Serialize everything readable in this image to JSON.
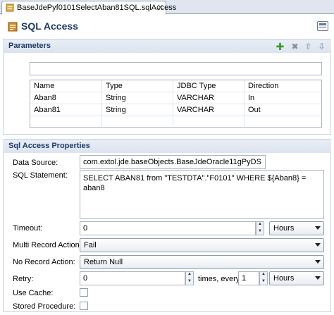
{
  "editor_tab": {
    "label": "BaseJdePyf0101SelectAban81SQL.sqlAccess",
    "close": "✕"
  },
  "header": {
    "title": "SQL Access"
  },
  "parameters": {
    "title": "Parameters",
    "filter_value": "",
    "columns": [
      "Name",
      "Type",
      "JDBC Type",
      "Direction"
    ],
    "rows": [
      [
        "Aban8",
        "String",
        "VARCHAR",
        "In"
      ],
      [
        "Aban81",
        "String",
        "VARCHAR",
        "Out"
      ]
    ]
  },
  "properties": {
    "title": "Sql Access Properties",
    "data_source_label": "Data Source:",
    "data_source_value": "com.extol.jde.baseObjects.BaseJdeOracle11gPyDS",
    "sql_label": "SQL Statement:",
    "sql_value": "SELECT ABAN81 from \"TESTDTA\".\"F0101\" WHERE ${Aban8} = aban8",
    "timeout_label": "Timeout:",
    "timeout_value": "0",
    "timeout_unit": "Hours",
    "multi_record_label": "Multi Record Action:",
    "multi_record_value": "Fail",
    "no_record_label": "No Record Action:",
    "no_record_value": "Return Null",
    "retry_label": "Retry:",
    "retry_value": "0",
    "retry_times_label": "times, every",
    "retry_every_value": "1",
    "retry_unit": "Hours",
    "use_cache_label": "Use Cache:",
    "stored_procedure_label": "Stored Procedure:",
    "use_cache_checked": false,
    "stored_procedure_checked": false
  },
  "colors": {
    "section_title": "#1c3a6b",
    "add_icon": "#3a9a2a"
  }
}
